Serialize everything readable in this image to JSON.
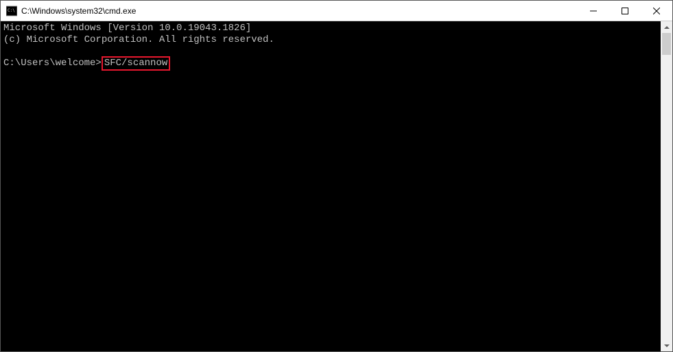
{
  "titlebar": {
    "title": "C:\\Windows\\system32\\cmd.exe"
  },
  "terminal": {
    "line1": "Microsoft Windows [Version 10.0.19043.1826]",
    "line2": "(c) Microsoft Corporation. All rights reserved.",
    "prompt": "C:\\Users\\welcome>",
    "command": "SFC/scannow"
  }
}
